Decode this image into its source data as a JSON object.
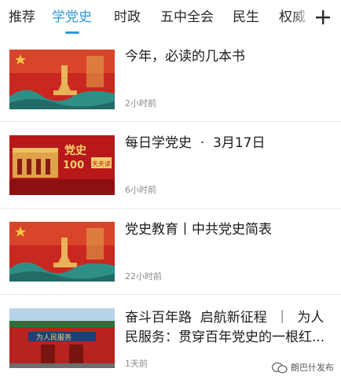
{
  "tabs": [
    {
      "label": "推荐",
      "active": false
    },
    {
      "label": "学党史",
      "active": true
    },
    {
      "label": "时政",
      "active": false
    },
    {
      "label": "五中全会",
      "active": false
    },
    {
      "label": "民生",
      "active": false
    },
    {
      "label": "权威",
      "active": false
    }
  ],
  "add_channel_icon": "plus-icon",
  "accent_color": "#2e9ad6",
  "articles": [
    {
      "title": "今年，必读的几本书",
      "time": "2小时前",
      "thumbnail": "party-history-banner-red-flag"
    },
    {
      "title": "每日学党史  ·  3月17日",
      "time": "6小时前",
      "thumbnail": "tiananmen-100-years-banner",
      "thumb_text": "党史",
      "thumb_number": "100",
      "thumb_badge": "天天读"
    },
    {
      "title": "党史教育丨中共党史简表",
      "time": "22小时前",
      "thumbnail": "party-history-banner-red-flag"
    },
    {
      "title": "奋斗百年路  启航新征程  ｜  为人民服务：贯穿百年党史的一根红...",
      "time": "1天前",
      "thumbnail": "red-gate-palace-photo",
      "thumb_text": "为人民服务"
    }
  ],
  "watermark": {
    "text": "朗巴什发布",
    "icon": "wechat-channel-icon"
  }
}
